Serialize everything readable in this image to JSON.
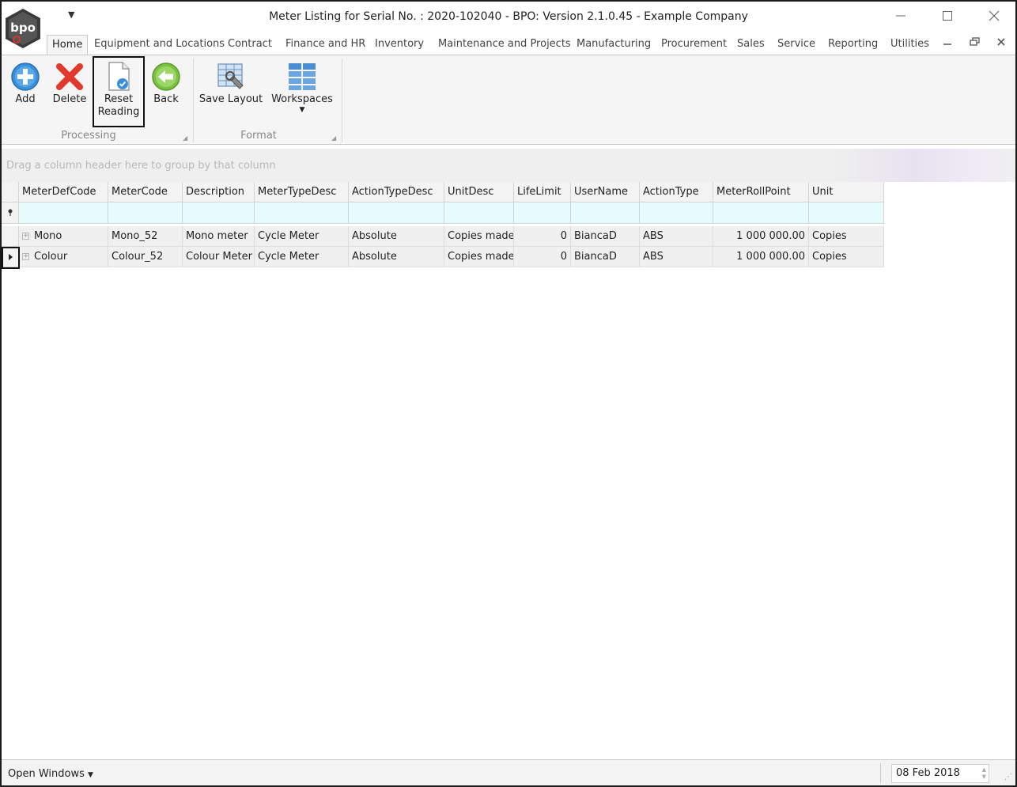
{
  "window": {
    "title": "Meter Listing for Serial No. : 2020-102040 - BPO: Version 2.1.0.45 - Example Company",
    "logo_text": "bpo"
  },
  "ribbon_tabs": [
    "Home",
    "Equipment and Locations",
    "Contract",
    "Finance and HR",
    "Inventory",
    "Maintenance and Projects",
    "Manufacturing",
    "Procurement",
    "Sales",
    "Service",
    "Reporting",
    "Utilities"
  ],
  "ribbon": {
    "processing": {
      "label": "Processing",
      "add": "Add",
      "delete": "Delete",
      "reset_line1": "Reset",
      "reset_line2": "Reading",
      "back": "Back"
    },
    "format": {
      "label": "Format",
      "save_layout": "Save Layout",
      "workspaces": "Workspaces"
    }
  },
  "grid": {
    "group_hint": "Drag a column header here to group by that column",
    "columns": [
      "MeterDefCode",
      "MeterCode",
      "Description",
      "MeterTypeDesc",
      "ActionTypeDesc",
      "UnitDesc",
      "LifeLimit",
      "UserName",
      "ActionType",
      "MeterRollPoint",
      "Unit"
    ],
    "rows": [
      [
        "Mono",
        "Mono_52",
        "Mono meter",
        "Cycle Meter",
        "Absolute",
        "Copies made",
        "0",
        "BiancaD",
        "ABS",
        "1 000 000.00",
        "Copies"
      ],
      [
        "Colour",
        "Colour_52",
        "Colour Meter",
        "Cycle Meter",
        "Absolute",
        "Copies made",
        "0",
        "BiancaD",
        "ABS",
        "1 000 000.00",
        "Copies"
      ]
    ]
  },
  "statusbar": {
    "open_windows": "Open Windows",
    "date": "08 Feb 2018"
  },
  "colors": {
    "filter_row": "#e6fbfb",
    "highlight_border": "#111111",
    "add_icon": "#3a8fd8",
    "delete_icon": "#e03a2f",
    "back_icon": "#7ac143"
  }
}
